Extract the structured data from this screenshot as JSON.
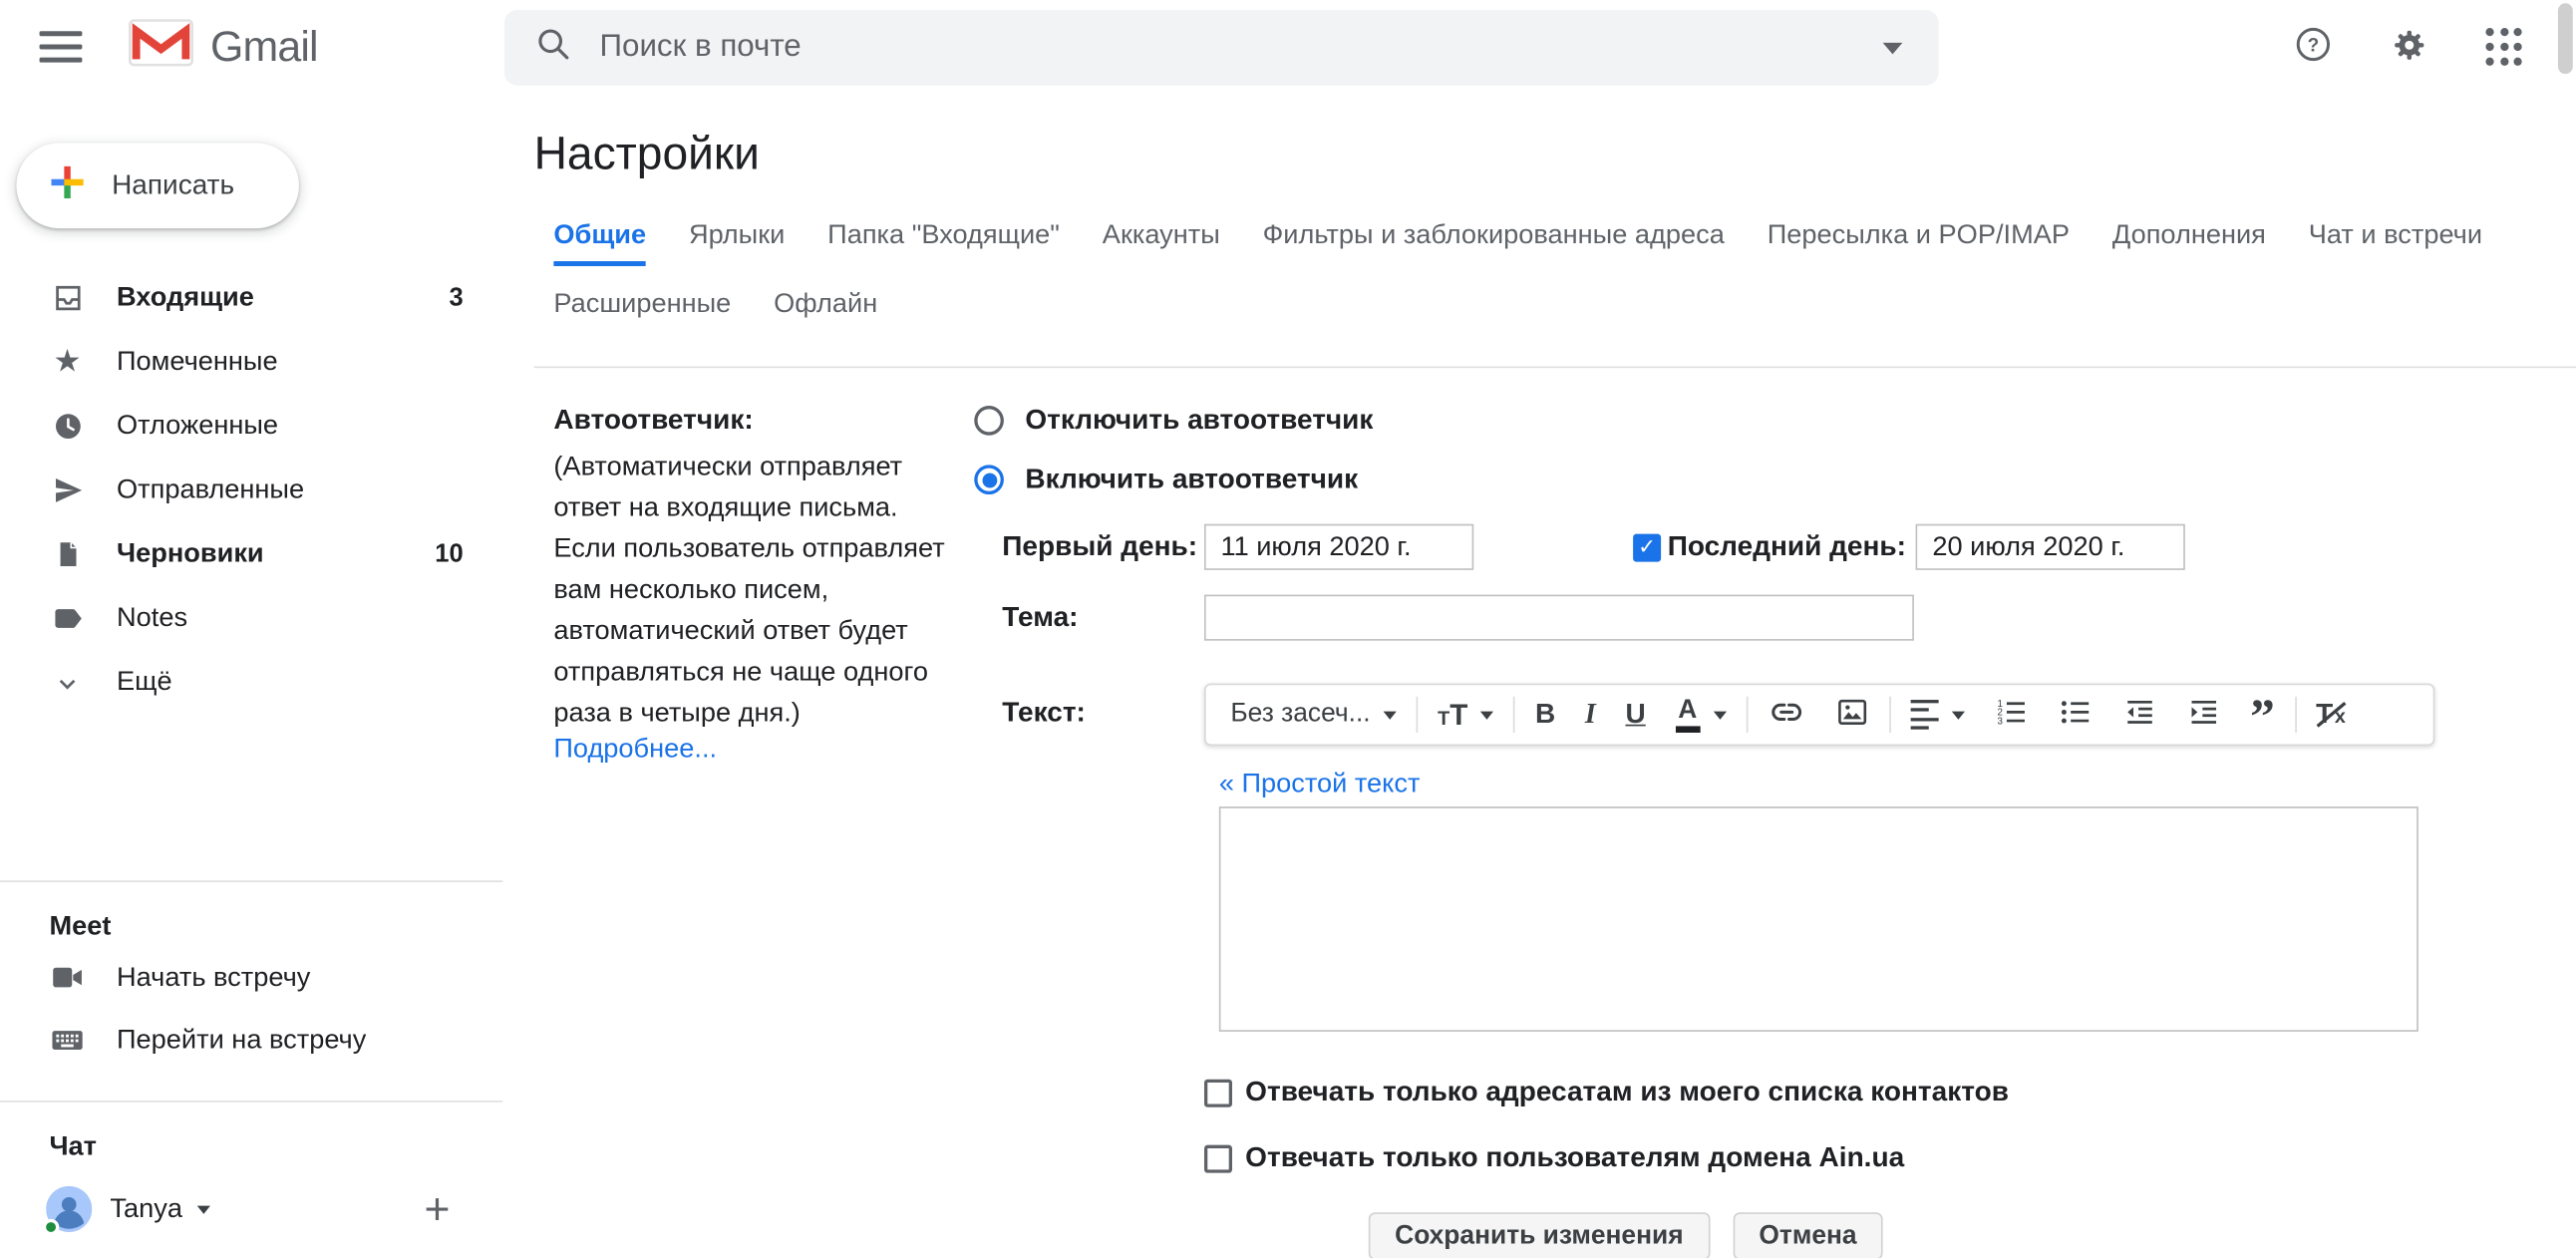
{
  "header": {
    "logo_text": "Gmail",
    "search_placeholder": "Поиск в почте"
  },
  "sidebar": {
    "compose_label": "Написать",
    "items": [
      {
        "label": "Входящие",
        "count": "3"
      },
      {
        "label": "Помеченные"
      },
      {
        "label": "Отложенные"
      },
      {
        "label": "Отправленные"
      },
      {
        "label": "Черновики",
        "count": "10"
      },
      {
        "label": "Notes"
      },
      {
        "label": "Ещё"
      }
    ],
    "meet_title": "Meet",
    "meet_items": [
      {
        "label": "Начать встречу"
      },
      {
        "label": "Перейти на встречу"
      }
    ],
    "chat_title": "Чат",
    "chat_user": "Tanya"
  },
  "settings": {
    "title": "Настройки",
    "tabs_row1": [
      "Общие",
      "Ярлыки",
      "Папка \"Входящие\"",
      "Аккаунты",
      "Фильтры и заблокированные адреса",
      "Пересылка и POP/IMAP",
      "Дополнения",
      "Чат и встречи"
    ],
    "tabs_row2": [
      "Расширенные",
      "Офлайн"
    ],
    "active_tab": "Общие"
  },
  "vacation": {
    "label": "Автоответчик:",
    "description": "(Автоматически отправляет ответ на входящие письма. Если пользователь отправляет вам несколько писем, автоматический ответ будет отправляться не чаще одного раза в четыре дня.)",
    "more_link": "Подробнее...",
    "radio_off": "Отключить автоответчик",
    "radio_on": "Включить автоответчик",
    "first_day_label": "Первый день:",
    "first_day_value": "11 июля 2020 г.",
    "last_day_label": "Последний день:",
    "last_day_value": "20 июля 2020 г.",
    "subject_label": "Тема:",
    "body_label": "Текст:",
    "plain_text_link": "« Простой текст",
    "contacts_only": "Отвечать только адресатам из моего списка контактов",
    "domain_only": "Отвечать только пользователям домена Ain.ua",
    "save_button": "Сохранить изменения",
    "cancel_button": "Отмена"
  },
  "toolbar": {
    "font_label": "Без засеч...",
    "size_small": "T",
    "size_big": "T",
    "bold_label": "B",
    "italic_label": "I",
    "underline_label": "U",
    "color_label": "A",
    "quote_glyph": "”",
    "clear_t": "T",
    "clear_x": "x"
  },
  "colors": {
    "accent_blue": "#1a73e8",
    "text_dark": "#202124",
    "text_gray": "#5f6368",
    "search_bg": "#f1f3f4"
  }
}
